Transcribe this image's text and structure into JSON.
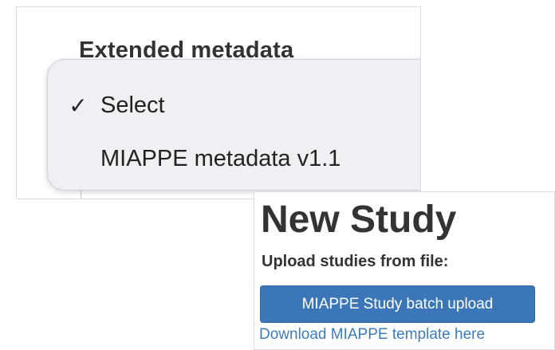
{
  "extended_metadata": {
    "heading": "Extended metadata",
    "dropdown": {
      "options": [
        {
          "label": "Select",
          "checked": true,
          "check_mark": "✓"
        },
        {
          "label": "MIAPPE metadata v1.1",
          "checked": false,
          "check_mark": ""
        }
      ]
    }
  },
  "new_study": {
    "title": "New Study",
    "upload_label": "Upload studies from file:",
    "batch_upload_button": "MIAPPE Study batch upload",
    "template_link": "Download MIAPPE template here"
  },
  "colors": {
    "button_bg": "#3b77b8",
    "link": "#3c7bbd",
    "menu_bg": "#eef0f4",
    "text": "#333333"
  },
  "icons": {
    "checkmark": "checkmark-icon"
  }
}
